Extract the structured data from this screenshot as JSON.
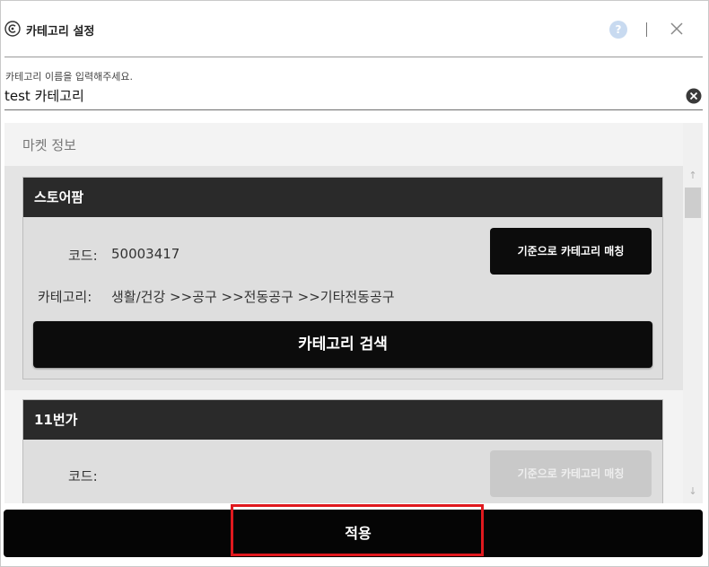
{
  "window": {
    "title": "카테고리 설정",
    "help_label": "?"
  },
  "name_field": {
    "label": "카테고리 이름을 입력해주세요.",
    "value": "test 카테고리"
  },
  "panel": {
    "section_title": "마켓 정보"
  },
  "markets": [
    {
      "name": "스토어팜",
      "code_label": "코드:",
      "code_value": "50003417",
      "category_label": "카테고리:",
      "category_value": "생활/건강 >>공구 >>전동공구 >>기타전동공구",
      "match_button": "기준으로 카테고리 매칭",
      "search_button": "카테고리 검색"
    },
    {
      "name": "11번가",
      "code_label": "코드:",
      "code_value": "",
      "match_button": "기준으로 카테고리 매칭",
      "match_disabled": true
    }
  ],
  "apply_button": "적용",
  "colors": {
    "header_dark": "#2a2a2a",
    "button_black": "#0c0c0c",
    "highlight_red": "#e0191e",
    "disabled_gray": "#c9c9c9"
  }
}
